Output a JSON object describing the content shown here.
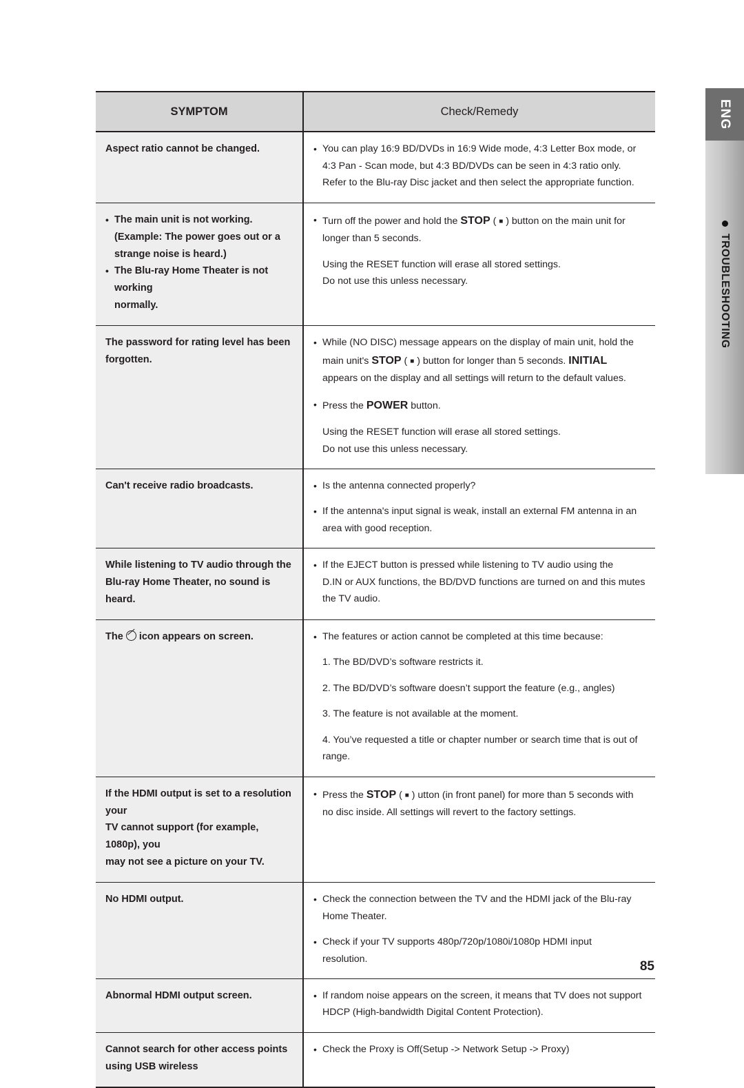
{
  "side_tab": {
    "lang": "ENG",
    "section": "TROUBLESHOOTING"
  },
  "page_number": "85",
  "table": {
    "headers": {
      "symptom": "SYMPTOM",
      "remedy": "Check/Remedy"
    },
    "rows": [
      {
        "symptom_lines": [
          {
            "text": "Aspect ratio cannot be changed.",
            "bullet": false
          }
        ],
        "remedy_lines": [
          {
            "text": "You can play 16:9 BD/DVDs in 16:9 Wide mode, 4:3 Letter Box mode, or",
            "bullet": true
          },
          {
            "text": "4:3 Pan - Scan mode, but 4:3 BD/DVDs can be seen in 4:3 ratio only.",
            "bullet": false,
            "indent": true
          },
          {
            "text": "Refer to the Blu-ray Disc jacket and then select the appropriate function.",
            "bullet": false,
            "indent": true
          }
        ]
      },
      {
        "symptom_lines": [
          {
            "text": "The main unit is not working.",
            "bullet": true
          },
          {
            "text": "(Example: The power goes out or a",
            "bullet": false,
            "indent": true
          },
          {
            "text": "strange noise is heard.)",
            "bullet": false,
            "indent": true
          },
          {
            "text": "The Blu-ray Home Theater is not working",
            "bullet": true
          },
          {
            "text": "normally.",
            "bullet": false,
            "indent": true
          }
        ],
        "remedy_lines": [
          {
            "html": "Turn off the power and hold the <b class=\"big\">STOP</b> ( <span class=\"sq\">&#9632;</span> ) button on the main unit for",
            "bullet": true
          },
          {
            "text": "longer than 5 seconds.",
            "bullet": false,
            "indent": true
          },
          {
            "gap": true
          },
          {
            "text": "Using the RESET function will erase all stored settings.",
            "bullet": false,
            "indent": true
          },
          {
            "text": "Do not use this unless necessary.",
            "bullet": false,
            "indent": true
          }
        ]
      },
      {
        "symptom_lines": [
          {
            "text": "The password for rating level has been",
            "bullet": false
          },
          {
            "text": "forgotten.",
            "bullet": false
          }
        ],
        "remedy_lines": [
          {
            "html": "While (NO DISC) message appears on the display of main unit, hold the",
            "bullet": true
          },
          {
            "html": "main unit's <b class=\"big\">STOP</b> ( <span class=\"sq\">&#9632;</span> ) button for longer than 5 seconds. <b class=\"big\">INITIAL</b>",
            "bullet": false,
            "indent": true
          },
          {
            "text": "appears on the display and all settings will return to the default values.",
            "bullet": false,
            "indent": true
          },
          {
            "gap": true
          },
          {
            "html": "Press the <b class=\"big\">POWER</b> button.",
            "bullet": true
          },
          {
            "gap": true
          },
          {
            "text": "Using the RESET function will erase all stored settings.",
            "bullet": false,
            "indent": true
          },
          {
            "text": "Do not use this unless necessary.",
            "bullet": false,
            "indent": true
          }
        ]
      },
      {
        "symptom_lines": [
          {
            "text": "Can't receive radio broadcasts.",
            "bullet": false
          }
        ],
        "remedy_lines": [
          {
            "text": "Is the antenna connected properly?",
            "bullet": true
          },
          {
            "gap": true
          },
          {
            "text": "If the antenna's input signal is weak, install an external FM antenna in an",
            "bullet": true
          },
          {
            "text": "area with good reception.",
            "bullet": false,
            "indent": true
          }
        ]
      },
      {
        "symptom_lines": [
          {
            "text": "While listening to TV audio through the",
            "bullet": false
          },
          {
            "text": "Blu-ray Home Theater, no sound is",
            "bullet": false
          },
          {
            "text": "heard.",
            "bullet": false
          }
        ],
        "remedy_lines": [
          {
            "text": "If the EJECT button is pressed while listening to TV audio using the",
            "bullet": true
          },
          {
            "text": "D.IN or AUX functions, the BD/DVD functions are turned on and this mutes",
            "bullet": false,
            "indent": true
          },
          {
            "text": "the TV audio.",
            "bullet": false,
            "indent": true
          }
        ]
      },
      {
        "symptom_lines": [
          {
            "html": "The <span class=\"noicon\"></span> icon appears on screen.",
            "bullet": false
          }
        ],
        "remedy_lines": [
          {
            "text": "The features or action cannot be completed at this time because:",
            "bullet": true
          },
          {
            "gap": true
          },
          {
            "text": "1. The BD/DVD’s software restricts it.",
            "bullet": false,
            "indent": true
          },
          {
            "gap": true
          },
          {
            "text": "2. The BD/DVD’s software doesn’t support the feature (e.g., angles)",
            "bullet": false,
            "indent": true
          },
          {
            "gap": true
          },
          {
            "text": "3. The feature is not available at the moment.",
            "bullet": false,
            "indent": true
          },
          {
            "gap": true
          },
          {
            "text": "4. You’ve requested a title or chapter number or search time that is out of range.",
            "bullet": false,
            "indent": true
          }
        ]
      },
      {
        "symptom_lines": [
          {
            "text": "If the HDMI output is set to a resolution your",
            "bullet": false
          },
          {
            "text": "TV cannot support (for example, 1080p), you",
            "bullet": false
          },
          {
            "text": "may not see a picture on your TV.",
            "bullet": false
          }
        ],
        "remedy_lines": [
          {
            "html": "Press the <b class=\"big\">STOP</b> ( <span class=\"sq\">&#9632;</span> ) utton (in front panel) for more than 5 seconds with",
            "bullet": true
          },
          {
            "text": "no disc inside. All settings will revert to the factory settings.",
            "bullet": false,
            "indent": true
          }
        ]
      },
      {
        "symptom_lines": [
          {
            "text": "No HDMI output.",
            "bullet": false
          }
        ],
        "remedy_lines": [
          {
            "text": "Check the connection between the TV and the HDMI jack of the Blu-ray",
            "bullet": true
          },
          {
            "text": "Home Theater.",
            "bullet": false,
            "indent": true
          },
          {
            "gap": true
          },
          {
            "text": "Check if your TV supports 480p/720p/1080i/1080p HDMI input",
            "bullet": true
          },
          {
            "text": "resolution.",
            "bullet": false,
            "indent": true
          }
        ]
      },
      {
        "symptom_lines": [
          {
            "text": "Abnormal HDMI output screen.",
            "bullet": false
          }
        ],
        "remedy_lines": [
          {
            "text": "If random noise appears on the screen, it means that TV does not support",
            "bullet": true
          },
          {
            "text": "HDCP (High-bandwidth Digital Content Protection).",
            "bullet": false,
            "indent": true
          }
        ]
      },
      {
        "symptom_lines": [
          {
            "text": "Cannot search for other access points",
            "bullet": false
          },
          {
            "text": "using USB wireless",
            "bullet": false
          }
        ],
        "remedy_lines": [
          {
            "text": "Check the Proxy is Off(Setup -> Network Setup -> Proxy)",
            "bullet": true
          }
        ]
      }
    ]
  }
}
